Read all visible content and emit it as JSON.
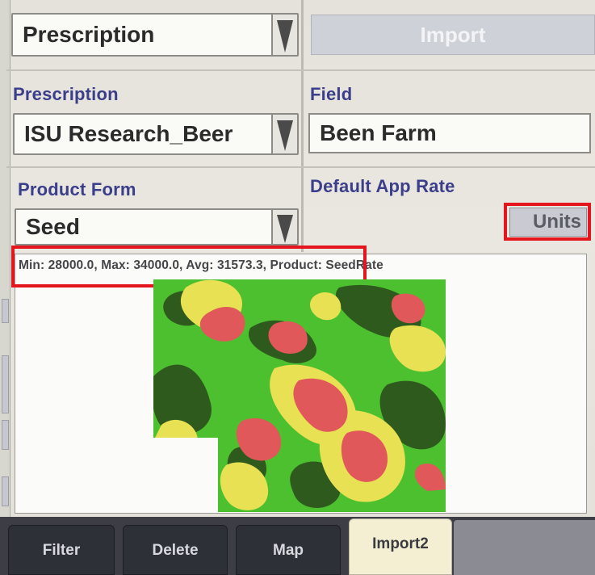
{
  "top": {
    "type_select_value": "Prescription",
    "import_button_label": "Import"
  },
  "prescription": {
    "label": "Prescription",
    "value": "ISU Research_Beer"
  },
  "field": {
    "label": "Field",
    "value": "Been Farm"
  },
  "product_form": {
    "label": "Product Form",
    "value": "Seed"
  },
  "default_app_rate": {
    "label": "Default App Rate",
    "units_button_label": "Units"
  },
  "map": {
    "stats_text": "Min: 28000.0, Max: 34000.0, Avg: 31573.3, Product: SeedRate",
    "legend_colors": {
      "low": "#2f5a1d",
      "mid_low": "#4cc02f",
      "mid": "#e8e153",
      "high": "#e0585a"
    }
  },
  "tabs": [
    {
      "label": "Filter",
      "active": false
    },
    {
      "label": "Delete",
      "active": false
    },
    {
      "label": "Map",
      "active": false
    },
    {
      "label": "Import2",
      "active": true
    }
  ],
  "colors": {
    "label_blue": "#3b3e8a",
    "highlight_red": "#e4151c"
  }
}
